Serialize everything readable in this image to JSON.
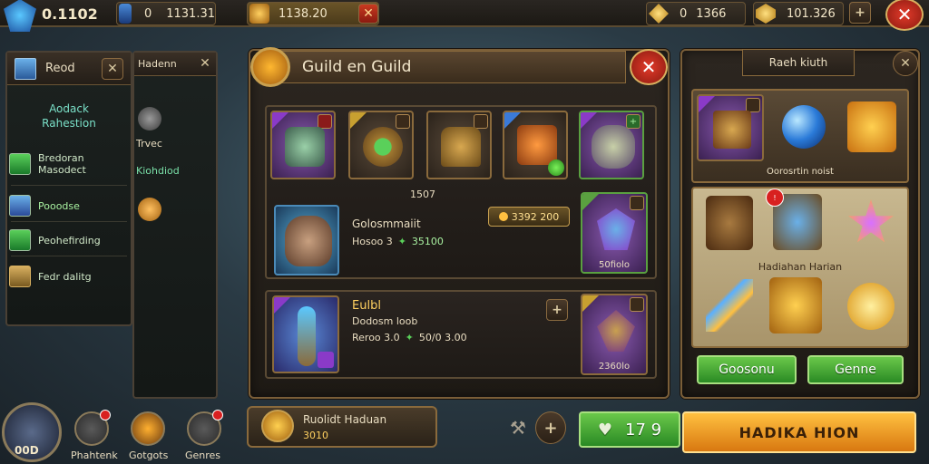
{
  "topbar": {
    "player_level": "0.1102",
    "resource1": "0",
    "resource1_value": "1131.31",
    "event_value": "1138.20",
    "gold_prefix": "0",
    "gold_value": "1366",
    "gem_value": "101.326"
  },
  "left_panel": {
    "header": "Reod",
    "section_title_line1": "Aodack",
    "section_title_line2": "Rahestion",
    "items": [
      {
        "label_line1": "Bredoran",
        "label_line2": "Masodect",
        "icon": "shield-icon"
      },
      {
        "label_line1": "Pooodse",
        "label_line2": "",
        "icon": "gem-icon"
      },
      {
        "label_line1": "Peohefirding",
        "label_line2": "",
        "icon": "leaf-icon"
      },
      {
        "label_line1": "Fedr dalitg",
        "label_line2": "",
        "icon": "house-icon"
      }
    ]
  },
  "mid_left_panel": {
    "header": "Hadenn",
    "item1": "Trvec",
    "item2": "Kiohdiod"
  },
  "guild_panel": {
    "title": "Guild en Guild",
    "row_count": "1507",
    "member": {
      "name": "Golosmmaiit",
      "stat_prefix": "Hosoo 3",
      "stat_value": "35100",
      "price": "3392 200"
    },
    "featured_slot_label": "50fiolo",
    "bottom_item": {
      "name": "Eulbl",
      "subtitle": "Dodosm loob",
      "stat_prefix": "Reroo 3.0",
      "stat_value": "50/0 3.00",
      "slot_label": "2360lo"
    }
  },
  "reward_panel": {
    "header": "Raeh kiuth",
    "top_caption": "Oorosrtin noist",
    "mid_caption": "Hadiahan Harian",
    "btn_left": "Goosonu",
    "btn_right": "Genne"
  },
  "bottom": {
    "hero_label": "00D",
    "icons": [
      {
        "label": "Phahtenk"
      },
      {
        "label": "Gotgots"
      },
      {
        "label": "Genres"
      }
    ],
    "quest_title": "Ruolidt Haduan",
    "quest_value": "3010",
    "green_counter": "17 9",
    "main_button": "HADIKA HION"
  },
  "colors": {
    "accent_gold": "#d8b060",
    "close_red": "#e23a2a",
    "green_button": "#3a9a2a",
    "orange_button": "#f0a030"
  }
}
